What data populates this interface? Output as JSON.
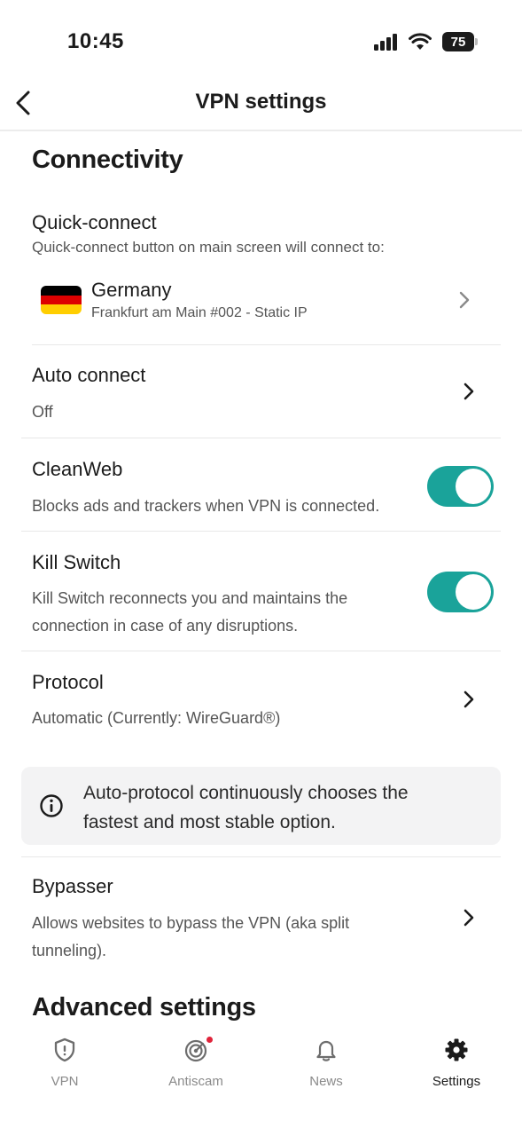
{
  "status": {
    "time": "10:45",
    "battery": "75"
  },
  "nav": {
    "title": "VPN settings"
  },
  "connectivity": {
    "title": "Connectivity",
    "quick_connect": {
      "title": "Quick-connect",
      "subtitle": "Quick-connect button on main screen will connect to:",
      "country": "Germany",
      "server": "Frankfurt am Main #002 - Static IP"
    },
    "auto_connect": {
      "title": "Auto connect",
      "value": "Off"
    },
    "cleanweb": {
      "title": "CleanWeb",
      "subtitle": "Blocks ads and trackers when VPN is connected.",
      "enabled": true
    },
    "kill_switch": {
      "title": "Kill Switch",
      "subtitle_line1": "Kill Switch reconnects you and maintains the",
      "subtitle_line2": "connection in case of any disruptions.",
      "enabled": true
    },
    "protocol": {
      "title": "Protocol",
      "value": "Automatic (Currently: WireGuard®)"
    },
    "info": {
      "line1": "Auto-protocol continuously chooses the",
      "line2": "fastest and most stable option."
    },
    "bypasser": {
      "title": "Bypasser",
      "subtitle_line1": "Allows websites to bypass the VPN (aka split",
      "subtitle_line2": "tunneling)."
    }
  },
  "advanced": {
    "title": "Advanced settings"
  },
  "tabs": [
    {
      "label": "VPN",
      "icon": "shield-icon",
      "active": false
    },
    {
      "label": "Antiscam",
      "icon": "radar-icon",
      "active": false,
      "badge": true
    },
    {
      "label": "News",
      "icon": "bell-icon",
      "active": false
    },
    {
      "label": "Settings",
      "icon": "gear-icon",
      "active": true
    }
  ],
  "colors": {
    "accent": "#1aa39a",
    "badge": "#e0233a",
    "flag": [
      "#000000",
      "#dd0000",
      "#ffce00"
    ]
  }
}
